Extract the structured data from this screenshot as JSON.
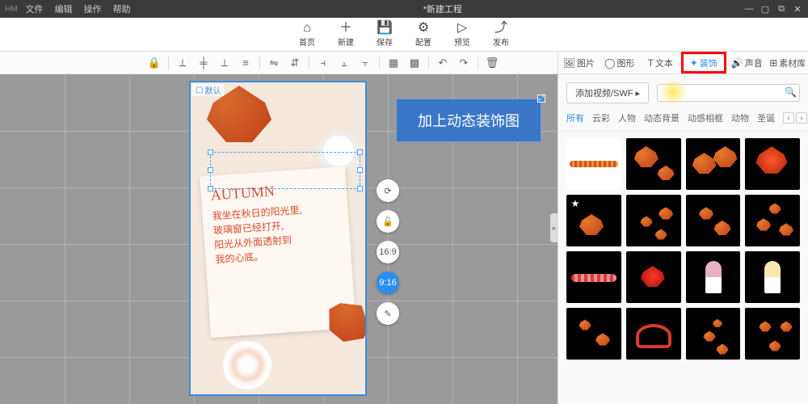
{
  "titlebar": {
    "app": "HM",
    "menus": [
      "文件",
      "编辑",
      "操作",
      "帮助"
    ],
    "title": "*新建工程"
  },
  "maintoolbar": [
    {
      "icon": "⌂",
      "label": "首页"
    },
    {
      "icon": "＋",
      "label": "新建"
    },
    {
      "icon": "💾",
      "label": "保存"
    },
    {
      "icon": "⚙",
      "label": "配置"
    },
    {
      "icon": "▷",
      "label": "预览"
    },
    {
      "icon": "⤴",
      "label": "发布"
    }
  ],
  "canvas": {
    "default_tag": "默认",
    "notebook_title": "AUTUMN",
    "notebook_lines": "我坐在秋日的阳光里,\n玻璃窗已经打开,\n阳光从外面透射到\n我的心底。",
    "blue_label_text": "加上动态装饰图",
    "aspect_16_9": "16:9",
    "aspect_9_16": "9:16"
  },
  "side_panel": {
    "tabs": [
      {
        "icon": "🖼",
        "label": "图片"
      },
      {
        "icon": "◯",
        "label": "图形"
      },
      {
        "icon": "T",
        "label": "文本"
      },
      {
        "icon": "✦",
        "label": "装饰"
      },
      {
        "icon": "🔊",
        "label": "声音"
      },
      {
        "icon": "⊞",
        "label": "素材库"
      }
    ],
    "add_button": "添加视频/SWF ▸",
    "search_placeholder": "",
    "filters": [
      "所有",
      "云彩",
      "人物",
      "动态背景",
      "动感相框",
      "动物",
      "圣诞"
    ]
  }
}
